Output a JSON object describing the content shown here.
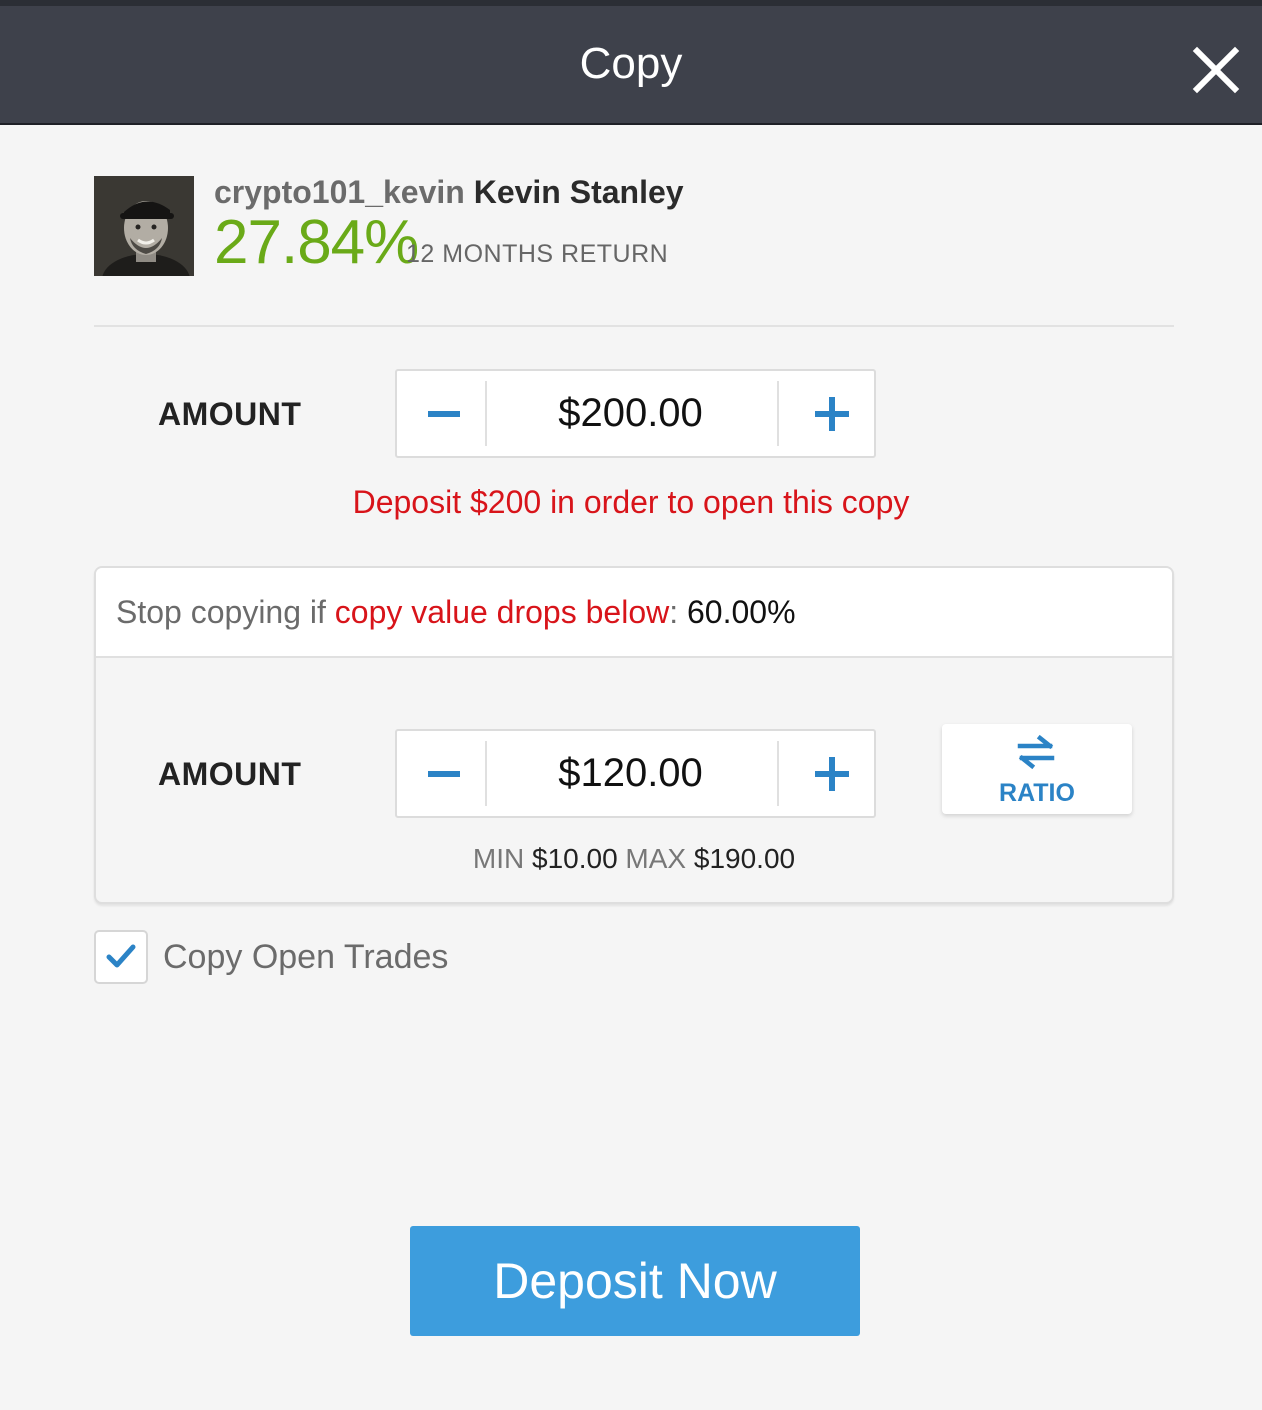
{
  "header": {
    "title": "Copy"
  },
  "trader": {
    "username": "crypto101_kevin",
    "full_name": "Kevin Stanley",
    "return_value": "27.84%",
    "return_label": "12 MONTHS RETURN"
  },
  "amount": {
    "label": "AMOUNT",
    "value": "$200.00",
    "warning": "Deposit $200 in order to open this copy"
  },
  "stop_loss": {
    "prefix": "Stop copying if ",
    "link_text": "copy value drops below",
    "colon": ":",
    "value": "60.00%",
    "amount_label": "AMOUNT",
    "amount_value": "$120.00",
    "min_label": "MIN",
    "min_value": "$10.00",
    "max_label": "MAX",
    "max_value": "$190.00",
    "ratio_label": "RATIO"
  },
  "copy_open_trades": {
    "label": "Copy Open Trades",
    "checked": true
  },
  "actions": {
    "deposit_label": "Deposit Now"
  },
  "colors": {
    "header_bg": "#3e414b",
    "positive": "#6aaa18",
    "warning": "#d8141a",
    "accent": "#2b83c6",
    "primary_button": "#3d9ddd"
  },
  "icons": {
    "close": "close-icon",
    "minus": "minus-icon",
    "plus": "plus-icon",
    "ratio": "swap-arrows-icon",
    "check": "checkmark-icon"
  }
}
